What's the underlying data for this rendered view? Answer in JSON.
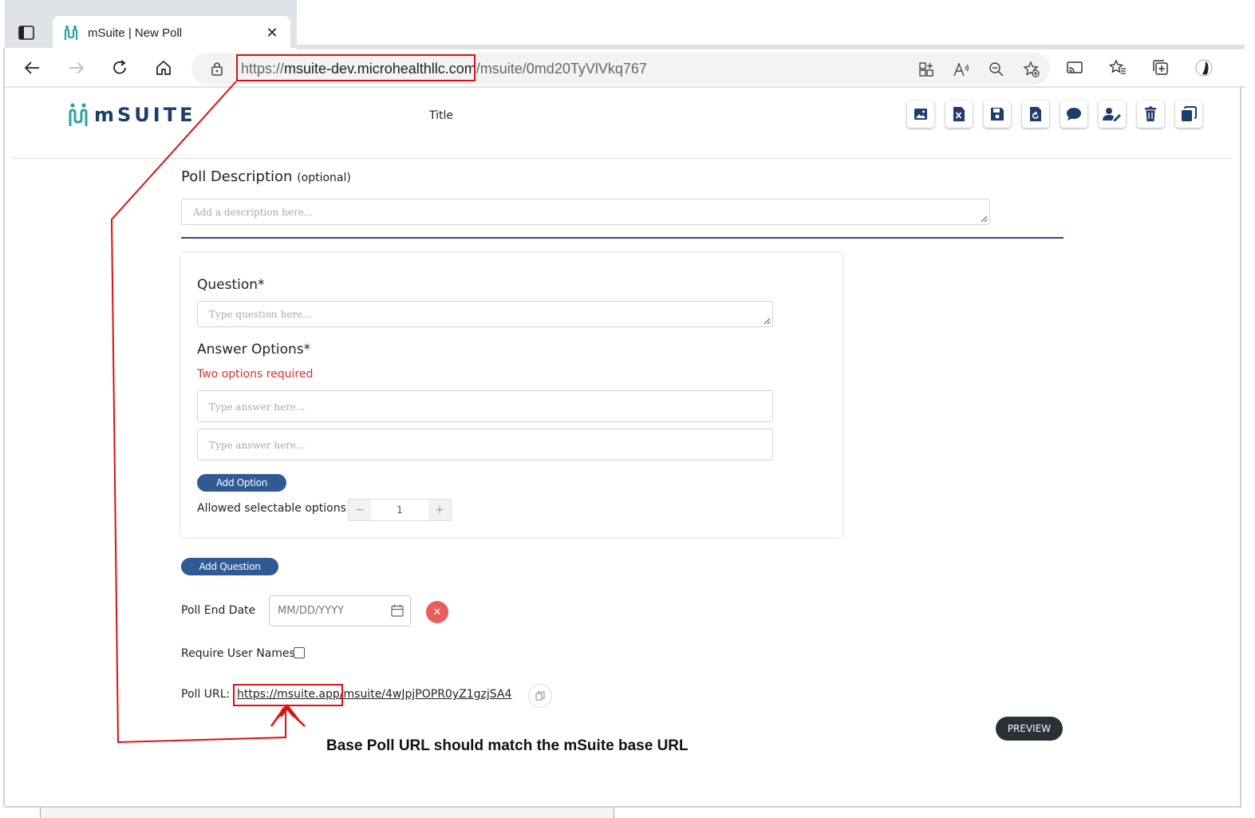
{
  "browser": {
    "tab_title": "mSuite | New Poll",
    "tab_close": "✕",
    "url_proto": "https://",
    "url_host": "msuite-dev.microhealthllc.com",
    "url_path": "/msuite/0md20TyVlVkq767"
  },
  "header": {
    "logo_text": "mSUITE",
    "title": "Title",
    "actions": [
      "image-icon",
      "excel-icon",
      "save-icon",
      "reset-icon",
      "comment-icon",
      "user-edit-icon",
      "trash-icon",
      "copy-icon"
    ]
  },
  "form": {
    "description_label": "Poll Description",
    "description_optional": "(optional)",
    "description_placeholder": "Add a description here...",
    "question_label": "Question*",
    "question_placeholder": "Type question here...",
    "answers_label": "Answer Options*",
    "answers_error": "Two options required",
    "answer_placeholders": [
      "Type answer here...",
      "Type answer here..."
    ],
    "add_option_label": "Add Option",
    "allowed_label": "Allowed selectable options",
    "allowed_value": "1",
    "stepper_minus": "−",
    "stepper_plus": "+",
    "add_question_label": "Add Question",
    "end_date_label": "Poll End Date",
    "end_date_placeholder": "MM/DD/YYYY",
    "clear_label": "✕",
    "require_names_label": "Require User Names",
    "require_names_checked": false,
    "poll_url_label": "Poll URL:",
    "poll_url_base": "https://msuite.app",
    "poll_url_path": "/msuite/4wJpjPOPR0yZ1gzjSA4",
    "preview_label": "PREVIEW"
  },
  "annotation": {
    "note": "Base Poll URL should match the mSuite base URL",
    "color": "#e01010"
  },
  "colors": {
    "brand_blue": "#2f5a94",
    "logo_teal": "#2aa3a3",
    "error_red": "#d93030",
    "clear_red": "#e85e5e",
    "preview_dark": "#2b2f36"
  }
}
